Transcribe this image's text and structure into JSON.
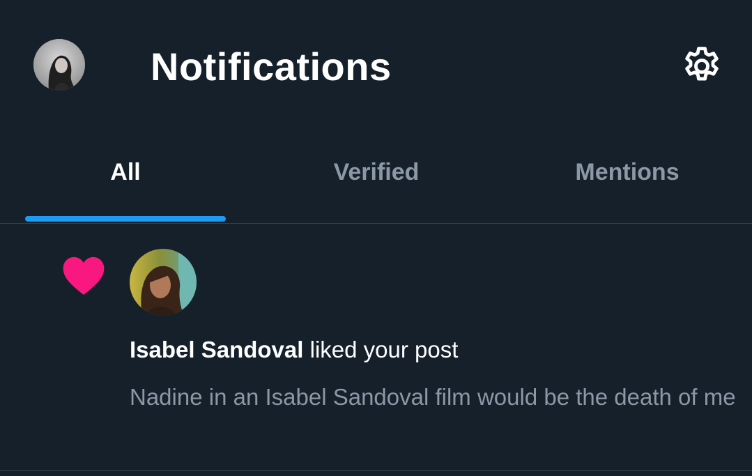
{
  "header": {
    "title": "Notifications",
    "avatar_icon": "user-avatar",
    "settings_icon": "gear-icon"
  },
  "tabs": [
    {
      "label": "All",
      "active": true
    },
    {
      "label": "Verified",
      "active": false
    },
    {
      "label": "Mentions",
      "active": false
    }
  ],
  "notification": {
    "type_icon": "heart-icon",
    "actor_name": "Isabel Sandoval",
    "action": "liked your post",
    "post_preview": "Nadine in an Isabel Sandoval film would be the death of me"
  },
  "colors": {
    "background": "#15202b",
    "accent": "#1d9bf0",
    "like": "#f91880",
    "secondary_text": "#8b98a5",
    "divider": "#38444d"
  }
}
